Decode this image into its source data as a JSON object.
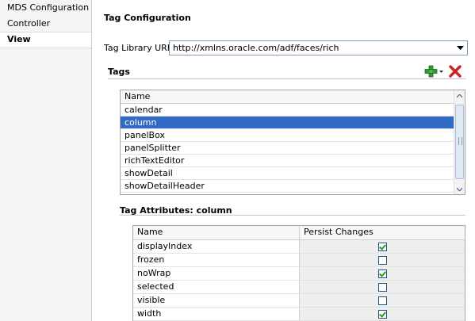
{
  "nav": {
    "items": [
      {
        "label": "MDS Configuration",
        "selected": false
      },
      {
        "label": "Controller",
        "selected": false
      },
      {
        "label": "View",
        "selected": true
      }
    ]
  },
  "main": {
    "title": "Tag Configuration",
    "uri_label": "Tag Library URI:",
    "uri_value": "http://xmlns.oracle.com/adf/faces/rich",
    "tags_header": "Tags",
    "tags_table": {
      "column": "Name",
      "rows": [
        "calendar",
        "column",
        "panelBox",
        "panelSplitter",
        "richTextEditor",
        "showDetail",
        "showDetailHeader"
      ],
      "selected_index": 1
    },
    "attributes_header": "Tag Attributes: column",
    "attributes_table": {
      "columns": [
        "Name",
        "Persist Changes"
      ],
      "rows": [
        {
          "name": "displayIndex",
          "persist": true
        },
        {
          "name": "frozen",
          "persist": false
        },
        {
          "name": "noWrap",
          "persist": true
        },
        {
          "name": "selected",
          "persist": false
        },
        {
          "name": "visible",
          "persist": false
        },
        {
          "name": "width",
          "persist": true
        }
      ]
    }
  },
  "icons": {
    "add": "add-plus-icon",
    "delete": "delete-x-icon"
  },
  "colors": {
    "selection": "#316ac5",
    "add_icon": "#2e9c2e",
    "delete_icon": "#d42020"
  }
}
